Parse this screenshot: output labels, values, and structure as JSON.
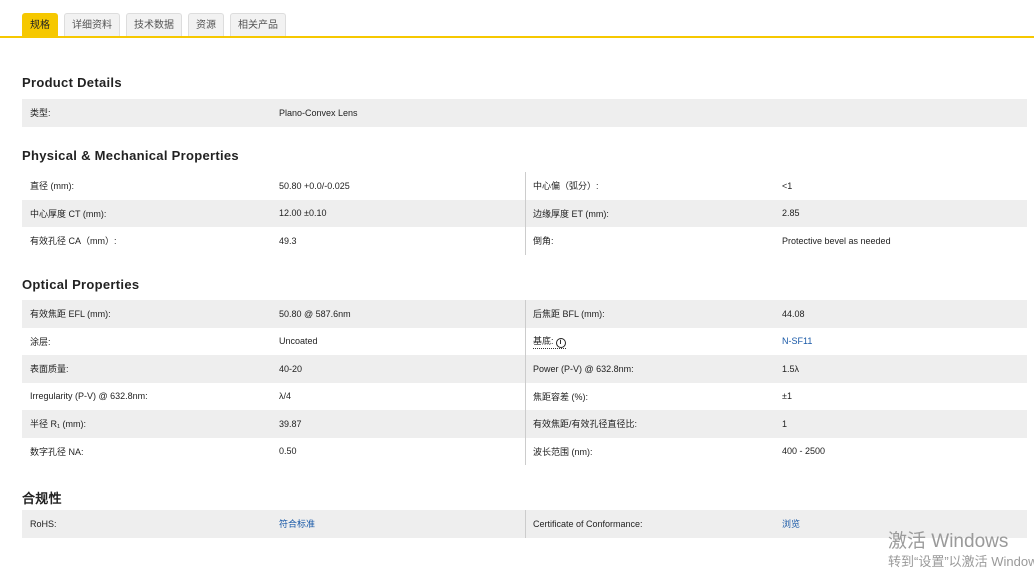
{
  "tabs": [
    "规格",
    "详细资料",
    "技术数据",
    "资源",
    "相关产品"
  ],
  "sections": {
    "product": {
      "title": "Product Details",
      "rows": [
        {
          "label": "类型:",
          "value": "Plano-Convex Lens"
        }
      ]
    },
    "physical": {
      "title": "Physical & Mechanical Properties",
      "rows": [
        {
          "l1": "直径 (mm):",
          "v1": "50.80 +0.0/-0.025",
          "l2": "中心偏（弧分）:",
          "v2": "<1"
        },
        {
          "l1": "中心厚度 CT (mm):",
          "v1": "12.00 ±0.10",
          "l2": "边缘厚度 ET (mm):",
          "v2": "2.85"
        },
        {
          "l1": "有效孔径 CA（mm）:",
          "v1": "49.3",
          "l2": "倒角:",
          "v2": "Protective bevel as needed"
        }
      ]
    },
    "optical": {
      "title": "Optical Properties",
      "rows": [
        {
          "l1": "有效焦距 EFL (mm):",
          "v1": "50.80 @ 587.6nm",
          "l2": "后焦距 BFL (mm):",
          "v2": "44.08"
        },
        {
          "l1": "涂层:",
          "v1": "Uncoated",
          "l2": "基底:",
          "v2": "N-SF11"
        },
        {
          "l1": "表面质量:",
          "v1": "40-20",
          "l2": "Power (P-V) @ 632.8nm:",
          "v2": "1.5λ"
        },
        {
          "l1": "Irregularity (P-V) @ 632.8nm:",
          "v1": "λ/4",
          "l2": "焦距容差 (%):",
          "v2": "±1"
        },
        {
          "l1": "半径 R₁ (mm):",
          "v1": "39.87",
          "l2": "有效焦距/有效孔径直径比:",
          "v2": "1"
        },
        {
          "l1": "数字孔径 NA:",
          "v1": "0.50",
          "l2": "波长范围 (nm):",
          "v2": "400 - 2500"
        }
      ]
    },
    "compliance": {
      "title": "合规性",
      "rows": [
        {
          "l1": "RoHS:",
          "v1": "符合标准",
          "l2": "Certificate of Conformance:",
          "v2": "浏览"
        }
      ]
    }
  },
  "watermark": {
    "line1": "激活 Windows",
    "line2": "转到“设置”以激活 Windows。"
  },
  "colors": {
    "accent": "#f6c800",
    "link": "#1a5aa8",
    "row_alt": "#eeeeee"
  }
}
